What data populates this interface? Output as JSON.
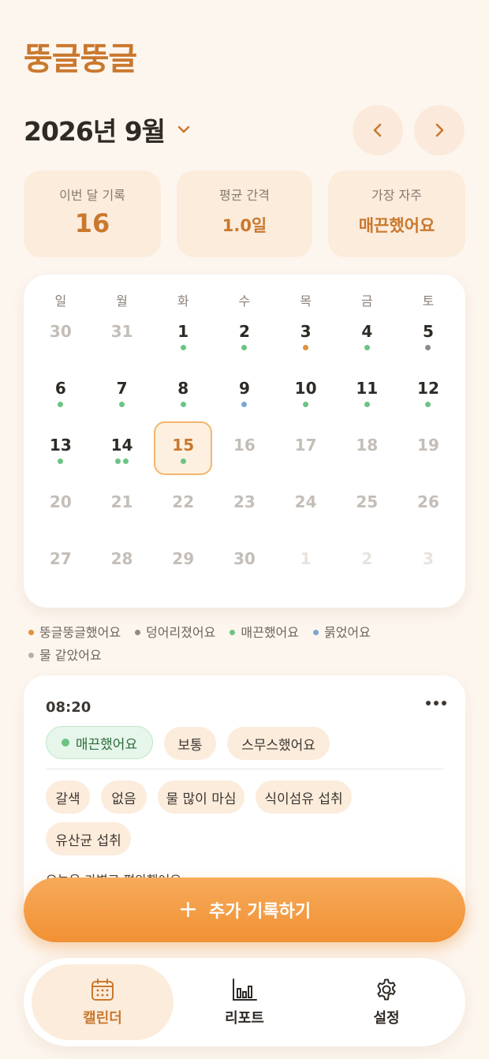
{
  "app": {
    "title": "뚱글뚱글"
  },
  "header": {
    "month_label": "2026년 9월"
  },
  "stats": [
    {
      "label": "이번 달 기록",
      "value": "16"
    },
    {
      "label": "평균 간격",
      "value": "1.0일"
    },
    {
      "label": "가장 자주",
      "value": "매끈했어요"
    }
  ],
  "calendar": {
    "weekdays": [
      "일",
      "월",
      "화",
      "수",
      "목",
      "금",
      "토"
    ],
    "weeks": [
      [
        {
          "d": "30",
          "muted": true,
          "dots": []
        },
        {
          "d": "31",
          "muted": true,
          "dots": []
        },
        {
          "d": "1",
          "dots": [
            "green"
          ]
        },
        {
          "d": "2",
          "dots": [
            "green"
          ]
        },
        {
          "d": "3",
          "dots": [
            "orange"
          ]
        },
        {
          "d": "4",
          "dots": [
            "green"
          ]
        },
        {
          "d": "5",
          "dots": [
            "gray"
          ]
        }
      ],
      [
        {
          "d": "6",
          "dots": [
            "green"
          ]
        },
        {
          "d": "7",
          "dots": [
            "green"
          ]
        },
        {
          "d": "8",
          "dots": [
            "green"
          ]
        },
        {
          "d": "9",
          "dots": [
            "blue"
          ]
        },
        {
          "d": "10",
          "dots": [
            "green"
          ]
        },
        {
          "d": "11",
          "dots": [
            "green"
          ]
        },
        {
          "d": "12",
          "dots": [
            "green"
          ]
        }
      ],
      [
        {
          "d": "13",
          "dots": [
            "green"
          ]
        },
        {
          "d": "14",
          "dots": [
            "green",
            "green"
          ]
        },
        {
          "d": "15",
          "today": true,
          "dots": [
            "green"
          ]
        },
        {
          "d": "16",
          "muted": true,
          "dots": []
        },
        {
          "d": "17",
          "muted": true,
          "dots": []
        },
        {
          "d": "18",
          "muted": true,
          "dots": []
        },
        {
          "d": "19",
          "muted": true,
          "dots": []
        }
      ],
      [
        {
          "d": "20",
          "muted": true,
          "dots": []
        },
        {
          "d": "21",
          "muted": true,
          "dots": []
        },
        {
          "d": "22",
          "muted": true,
          "dots": []
        },
        {
          "d": "23",
          "muted": true,
          "dots": []
        },
        {
          "d": "24",
          "muted": true,
          "dots": []
        },
        {
          "d": "25",
          "muted": true,
          "dots": []
        },
        {
          "d": "26",
          "muted": true,
          "dots": []
        }
      ],
      [
        {
          "d": "27",
          "muted": true,
          "dots": []
        },
        {
          "d": "28",
          "muted": true,
          "dots": []
        },
        {
          "d": "29",
          "muted": true,
          "dots": []
        },
        {
          "d": "30",
          "muted": true,
          "dots": []
        },
        {
          "d": "1",
          "faint": true,
          "dots": []
        },
        {
          "d": "2",
          "faint": true,
          "dots": []
        },
        {
          "d": "3",
          "faint": true,
          "dots": []
        }
      ]
    ]
  },
  "legend": [
    {
      "label": "뚱글뚱글했어요",
      "color": "orange"
    },
    {
      "label": "덩어리졌어요",
      "color": "gray"
    },
    {
      "label": "매끈했어요",
      "color": "green"
    },
    {
      "label": "묽었어요",
      "color": "blue"
    },
    {
      "label": "물 같았어요",
      "color": "lightgray"
    }
  ],
  "colors": {
    "orange": "#e0913e",
    "gray": "#8f8a86",
    "green": "#6cc483",
    "blue": "#7aa6d4",
    "lightgray": "#b5b1ad",
    "accent": "#c9782e"
  },
  "entry": {
    "time": "08:20",
    "chips": [
      "매끈했어요",
      "보통",
      "스무스했어요"
    ],
    "tags": [
      "갈색",
      "없음",
      "물 많이 마심",
      "식이섬유 섭취",
      "유산균 섭취"
    ],
    "note": "오늘은 가볍고 편안했어요"
  },
  "add_button": {
    "label": "추가 기록하기",
    "icon": "plus-icon"
  },
  "tabs": [
    {
      "label": "캘린더",
      "icon": "calendar-icon",
      "active": true
    },
    {
      "label": "리포트",
      "icon": "bar-chart-icon"
    },
    {
      "label": "설정",
      "icon": "gear-icon"
    }
  ]
}
